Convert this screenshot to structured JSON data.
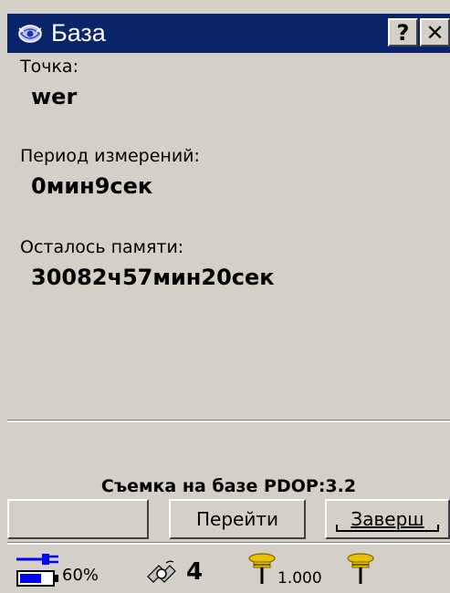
{
  "window": {
    "title": "База",
    "help_label": "?",
    "close_label": "✕"
  },
  "fields": {
    "point_label": "Точка:",
    "point_value": "wer",
    "period_label": "Период измерений:",
    "period_value": "0мин9сек",
    "memory_label": "Осталось памяти:",
    "memory_value": "30082ч57мин20сек"
  },
  "status_line": "Съемка на базе  PDOP:3.2",
  "buttons": {
    "blank_label": "",
    "goto_label": "Перейти",
    "finish_label": "Заверш"
  },
  "statusbar": {
    "battery_percent": "60%",
    "satellites": "4",
    "antenna_height": "1.000",
    "colors": {
      "power": "#0000ff",
      "antenna": "#e8c200"
    },
    "icons": [
      "power-plug-icon",
      "battery-icon",
      "satellite-icon",
      "antenna-icon",
      "base-antenna-icon"
    ]
  }
}
